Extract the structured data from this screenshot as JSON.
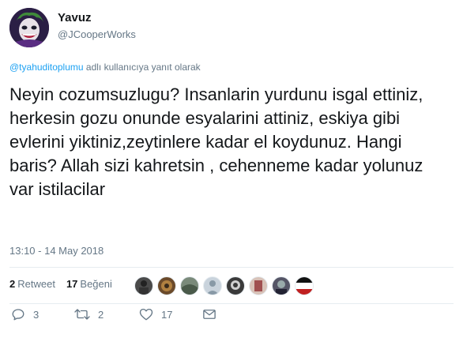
{
  "author": {
    "display_name": "Yavuz",
    "handle": "@JCooperWorks"
  },
  "reply_context": {
    "mention": "@tyahuditoplumu",
    "suffix": " adlı kullanıcıya yanıt olarak"
  },
  "tweet": {
    "text": "Neyin cozumsuzlugu? Insanlarin yurdunu isgal ettiniz, herkesin gozu onunde esyalarini attiniz, eskiya gibi evlerini yiktiniz,zeytinlere kadar el koydunuz. Hangi baris? Allah sizi kahretsin , cehenneme kadar yolunuz var istilacilar",
    "timestamp": "13:10 - 14 May 2018"
  },
  "stats": {
    "retweets_count": "2",
    "retweets_label": "Retweet",
    "likes_count": "17",
    "likes_label": "Beğeni"
  },
  "likers": [
    {
      "name": "liker-1",
      "color": "#4a4a4a"
    },
    {
      "name": "liker-2",
      "color": "#6b4a2a"
    },
    {
      "name": "liker-3",
      "color": "#7a8a7a"
    },
    {
      "name": "liker-4",
      "color": "#c9d3dc"
    },
    {
      "name": "liker-5",
      "color": "#3a3a3a"
    },
    {
      "name": "liker-6",
      "color": "#d8c2b8"
    },
    {
      "name": "liker-7",
      "color": "#555566"
    },
    {
      "name": "liker-8",
      "color": "#c02020"
    }
  ],
  "actions": {
    "reply_count": "3",
    "retweet_count": "2",
    "like_count": "17",
    "reply_icon": "reply-icon",
    "retweet_icon": "retweet-icon",
    "like_icon": "heart-icon",
    "dm_icon": "envelope-icon"
  },
  "colors": {
    "link": "#1da1f2",
    "muted": "#657786",
    "text": "#14171a",
    "divider": "#e6ecf0"
  }
}
